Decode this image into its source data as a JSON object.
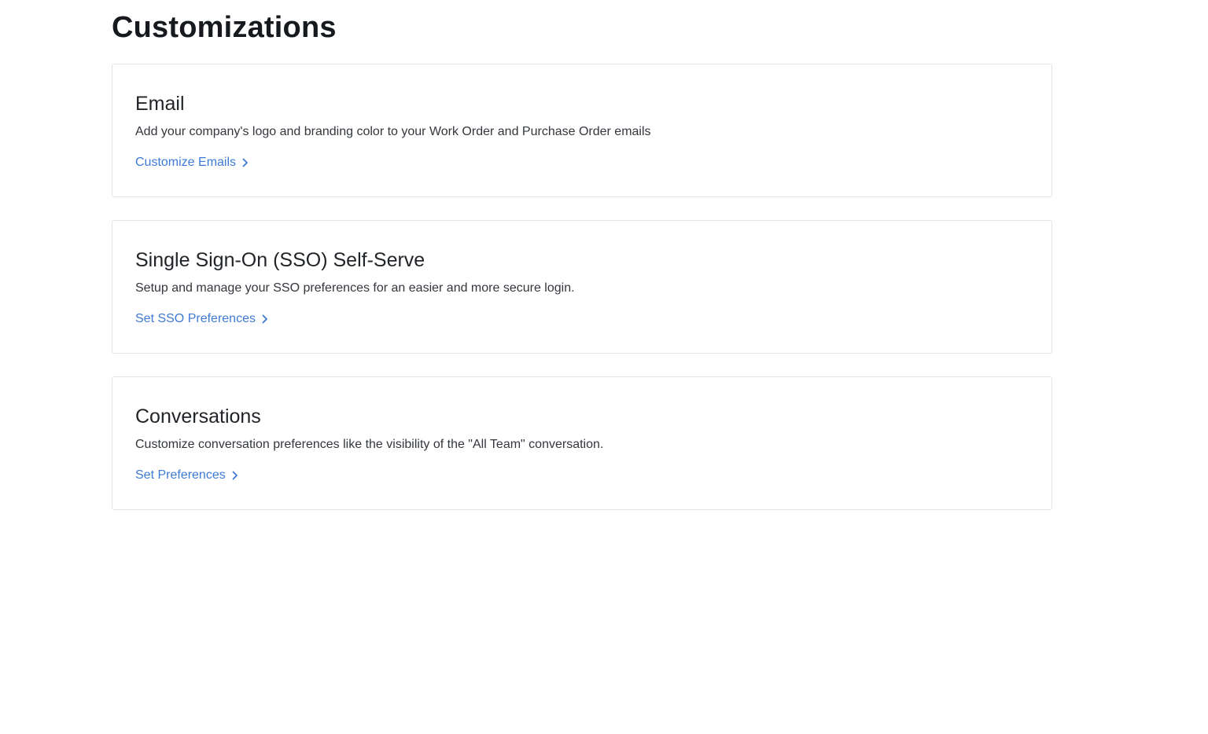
{
  "page": {
    "title": "Customizations"
  },
  "cards": [
    {
      "title": "Email",
      "description": "Add your company's logo and branding color to your Work Order and Purchase Order emails",
      "link_label": "Customize Emails",
      "link_icon": "chevron-right-icon"
    },
    {
      "title": "Single Sign-On (SSO) Self-Serve",
      "description": "Setup and manage your SSO preferences for an easier and more secure login.",
      "link_label": "Set SSO Preferences",
      "link_icon": "chevron-right-icon"
    },
    {
      "title": "Conversations",
      "description": "Customize conversation preferences like the visibility of the \"All Team\" conversation.",
      "link_label": "Set Preferences",
      "link_icon": "chevron-right-icon"
    }
  ],
  "colors": {
    "link": "#3e7ad6",
    "card_border": "#e2e4e8",
    "title_text": "#16191d"
  }
}
